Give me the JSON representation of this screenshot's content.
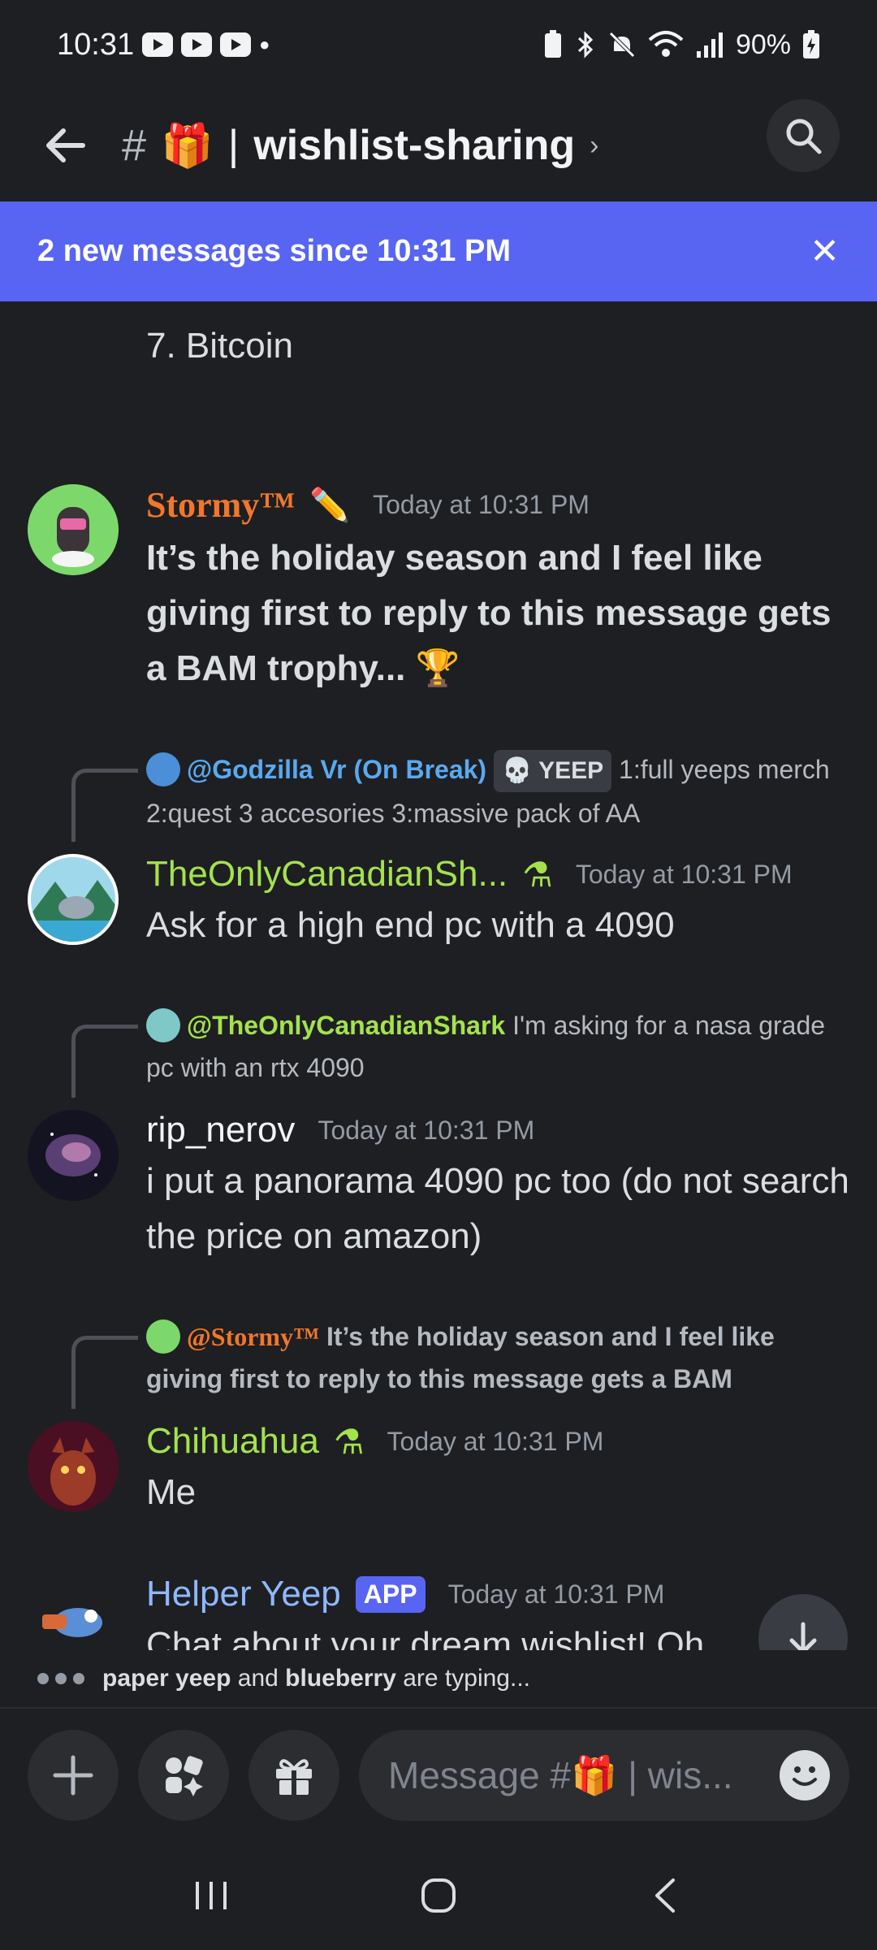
{
  "status_bar": {
    "time": "10:31",
    "battery": "90%"
  },
  "header": {
    "hash": "#",
    "channel_emoji": "🎁",
    "separator": "|",
    "channel_name": "wishlist-sharing",
    "chevron": "›"
  },
  "banner": {
    "text": "2 new messages since 10:31 PM",
    "close_label": "✕"
  },
  "prev_list_item": "7.  Bitcoin",
  "messages": [
    {
      "username": "Stormy™",
      "badge": "✏️",
      "timestamp": "Today at 10:31 PM",
      "content": "It’s the holiday season and I feel like giving first to reply to this message gets a BAM trophy... 🏆",
      "username_color": "#f0772b"
    },
    {
      "reply_to": "@Godzilla Vr (On Break)",
      "reply_tag": "💀 YEEP",
      "reply_text": "1:full yeeps merch 2:quest 3 accesories 3:massive pack of AA",
      "username": "TheOnlyCanadianSh...",
      "badge": "⚗",
      "timestamp": "Today at 10:31 PM",
      "content": "Ask for a high end pc with a 4090",
      "username_color": "#a4e24d"
    },
    {
      "reply_to": "@TheOnlyCanadianShark",
      "reply_text": "I'm asking for a nasa grade pc with an rtx 4090",
      "username": "rip_nerov",
      "timestamp": "Today at 10:31 PM",
      "content": "i put a panorama 4090 pc too (do not search the price on amazon)",
      "username_color": "#f2f3f5"
    },
    {
      "reply_to": "@Stormy™",
      "reply_text": "It’s the holiday season and I feel like giving first to reply to this message gets a BAM",
      "username": "Chihuahua",
      "badge": "⚗",
      "timestamp": "Today at 10:31 PM",
      "content": "Me",
      "username_color": "#a4e24d"
    },
    {
      "username": "Helper Yeep",
      "app_badge": "APP",
      "timestamp": "Today at 10:31 PM",
      "content": "Chat about your dream wishlist! Oh",
      "username_color": "#8fb8ff"
    }
  ],
  "typing": {
    "text_user1": "paper yeep",
    "text_and": "and",
    "text_user2": "blueberry",
    "text_suffix": "are typing..."
  },
  "composer": {
    "placeholder": "Message #🎁 | wis..."
  },
  "colors": {
    "accent": "#5865f2",
    "background": "#1e1f22"
  }
}
